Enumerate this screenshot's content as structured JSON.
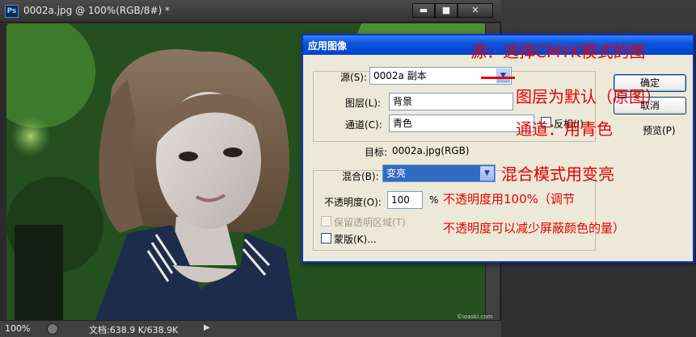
{
  "doc_window": {
    "ps_logo": "Ps",
    "title": "0002a.jpg @ 100%(RGB/8#) *",
    "buttons": {
      "minimize": "▬",
      "maximize": "■",
      "close": "✕"
    },
    "status": {
      "zoom": "100%",
      "doc_size": "文档:638.9 K/638.9K",
      "arrow": "▶"
    },
    "watermark": "©ioaski.com"
  },
  "dialog": {
    "title": "应用图像",
    "source": {
      "label": "源(S):",
      "value": "0002a 副本"
    },
    "layer": {
      "label": "图层(L):",
      "value": "背景"
    },
    "channel": {
      "label": "通道(C):",
      "value": "青色"
    },
    "invert": {
      "label": "反相(I)"
    },
    "target": {
      "label": "目标:",
      "value": "0002a.jpg(RGB)"
    },
    "blending": {
      "label": "混合(B):",
      "value": "变亮"
    },
    "opacity": {
      "label": "不透明度(O):",
      "value": "100",
      "unit": "%"
    },
    "preserve_transparency": {
      "label": "保留透明区域(T)"
    },
    "mask": {
      "label": "蒙版(K)..."
    },
    "ok_label": "确定",
    "cancel_label": "取消",
    "preview_label": "预览(P)"
  },
  "annotations": {
    "source_note": "源：选择CMYK模式的图",
    "layer_note": "图层为默认（原图）",
    "channel_note": "通道：用青色",
    "blend_note": "混合模式用变亮",
    "opacity_note_1": "不透明度用100%（调节",
    "opacity_note_2": "不透明度可以减少屏蔽颜色的量）"
  },
  "colors": {
    "annotation_red": "#e60000",
    "xp_title_blue": "#0a54e0",
    "selected_blue": "#316ac5"
  }
}
